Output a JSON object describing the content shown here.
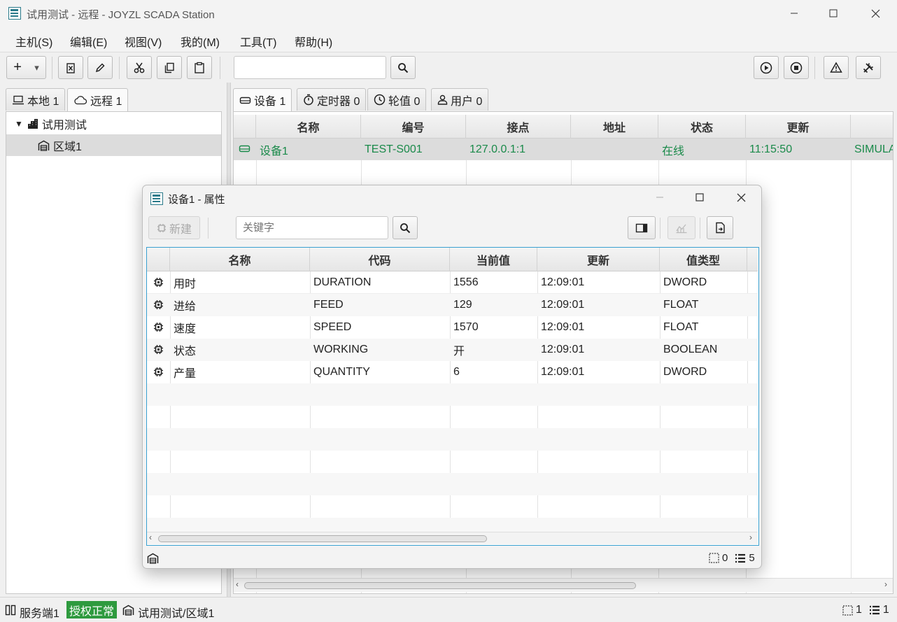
{
  "window": {
    "title": "试用测试 - 远程 - JOYZL SCADA Station",
    "min": "—",
    "max": "☐",
    "close": "✕"
  },
  "menu": [
    "主机(S)",
    "编辑(E)",
    "视图(V)",
    "我的(M)",
    "工具(T)",
    "帮助(H)"
  ],
  "toolbar": {
    "add": "+",
    "add_dropdown": "▾",
    "search_value": "",
    "search_icon": "search-icon"
  },
  "left_tabs": [
    {
      "label": "本地 1",
      "icon": "laptop-icon"
    },
    {
      "label": "远程 1",
      "icon": "cloud-icon"
    }
  ],
  "tree": {
    "root": "试用测试",
    "child": "区域1"
  },
  "right_tabs": [
    {
      "label": "设备 1",
      "icon": "device-icon"
    },
    {
      "label": "定时器 0",
      "icon": "timer-icon"
    },
    {
      "label": "轮值 0",
      "icon": "clock-icon"
    },
    {
      "label": "用户 0",
      "icon": "user-icon"
    }
  ],
  "device_table": {
    "columns": [
      "名称",
      "编号",
      "接点",
      "地址",
      "状态",
      "更新"
    ],
    "rows": [
      {
        "name": "设备1",
        "code": "TEST-S001",
        "endpoint": "127.0.0.1:1",
        "address": "",
        "status": "在线",
        "updated": "11:15:50",
        "extra": "SIMULA"
      }
    ]
  },
  "dialog": {
    "title": "设备1 - 属性",
    "new_label": "新建",
    "search_placeholder": "关键字",
    "columns": [
      "名称",
      "代码",
      "当前值",
      "更新",
      "值类型"
    ],
    "rows": [
      {
        "name": "用时",
        "code": "DURATION",
        "value": "1556",
        "updated": "12:09:01",
        "type": "DWORD"
      },
      {
        "name": "进给",
        "code": "FEED",
        "value": "129",
        "updated": "12:09:01",
        "type": "FLOAT"
      },
      {
        "name": "速度",
        "code": "SPEED",
        "value": "1570",
        "updated": "12:09:01",
        "type": "FLOAT"
      },
      {
        "name": "状态",
        "code": "WORKING",
        "value": "开",
        "updated": "12:09:01",
        "type": "BOOLEAN"
      },
      {
        "name": "产量",
        "code": "QUANTITY",
        "value": "6",
        "updated": "12:09:01",
        "type": "DWORD"
      }
    ],
    "status_selected": "0",
    "status_count": "5"
  },
  "statusbar": {
    "server": "服务端1",
    "license": "授权正常",
    "path": "试用测试/区域1",
    "selected": "1",
    "count": "1"
  },
  "colors": {
    "online": "#1a8a4a",
    "license_bg": "#2e9a3e",
    "accent": "#2a7a8a"
  }
}
